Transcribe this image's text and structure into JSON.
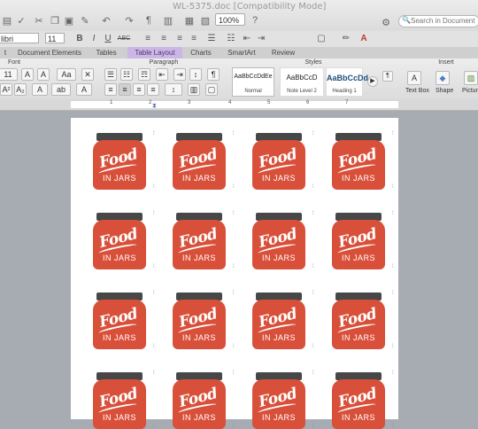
{
  "window": {
    "title": "WL-5375.doc [Compatibility Mode]",
    "zoom": "100%",
    "search_placeholder": "Search in Document"
  },
  "format_bar": {
    "font_name": "libri",
    "font_size": "11",
    "bold": "B",
    "italic": "I",
    "underline": "U",
    "strikethrough": "ABC"
  },
  "tabs": [
    {
      "label": "t"
    },
    {
      "label": "Document Elements"
    },
    {
      "label": "Tables"
    },
    {
      "label": "Table Layout",
      "active": true
    },
    {
      "label": "Charts"
    },
    {
      "label": "SmartArt"
    },
    {
      "label": "Review"
    }
  ],
  "ribbon": {
    "groups": {
      "font": "Font",
      "paragraph": "Paragraph",
      "styles": "Styles",
      "insert": "Insert"
    },
    "font_size": "11",
    "styles": [
      {
        "sample": "AaBbCcDdEe",
        "name": "Normal"
      },
      {
        "sample": "AaBbCcD",
        "name": "Note Level 2"
      },
      {
        "sample": "AaBbCcDd",
        "name": "Heading 1"
      }
    ],
    "insert": [
      {
        "label": "Text Box"
      },
      {
        "label": "Shape"
      },
      {
        "label": "Pictur"
      }
    ]
  },
  "ruler": {
    "numbers": [
      "1",
      "2",
      "3",
      "4",
      "5",
      "6",
      "7"
    ]
  },
  "label_design": {
    "line1": "Food",
    "line2": "IN JARS",
    "rows": 4,
    "cols": 4
  },
  "colors": {
    "jar_body": "#d9503a",
    "jar_lid": "#474747",
    "active_tab": "#cbb6e6"
  }
}
